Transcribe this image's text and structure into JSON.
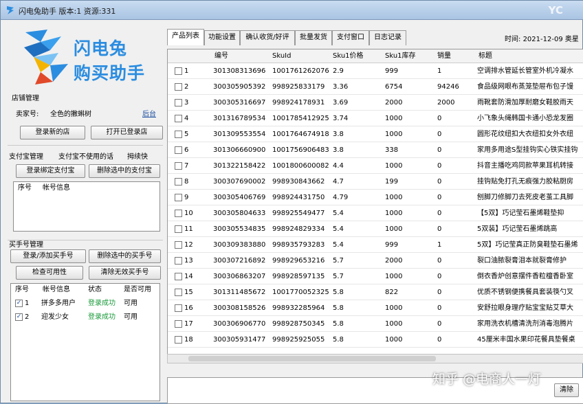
{
  "window": {
    "title": "闪电兔助手  版本:1  资源:331",
    "corner": "YC"
  },
  "logo": {
    "line1": "闪电兔",
    "line2": "购买助手"
  },
  "shop": {
    "section": "店铺管理",
    "seller_label": "卖家号:",
    "seller_value": "全色的撇蝌树",
    "backend_link": "后台",
    "login_new": "登录新的店",
    "open_logged": "打开已登录店"
  },
  "alipay": {
    "section": "支付宝管理",
    "note": "支付宝不使用的话",
    "shortcut": "拇续快",
    "bind_btn": "登录绑定支付宝",
    "delete_btn": "删除选中的支付宝",
    "headers": [
      "序号",
      "帐号信息"
    ]
  },
  "buyer": {
    "section": "买手号管理",
    "login_add": "登录/添加买手号",
    "delete_selected": "删除选中的买手号",
    "check": "检查可用性",
    "clear_invalid": "清除无效买手号",
    "headers": [
      "序号",
      "帐号信息",
      "状态",
      "是否可用"
    ],
    "rows": [
      {
        "index": "1",
        "account": "拼多多用户",
        "status": "登录成功",
        "usable": "可用"
      },
      {
        "index": "2",
        "account": "迎发少女",
        "status": "登录成功",
        "usable": "可用"
      }
    ]
  },
  "tabs": [
    "产品列表",
    "功能设置",
    "确认收货/好评",
    "批量发货",
    "支付窗口",
    "日志记录"
  ],
  "time": {
    "label": "时间:",
    "value": "2021-12-09 奥星"
  },
  "table": {
    "headers": [
      "编号",
      "SkuId",
      "Sku1价格",
      "Sku1库存",
      "销量",
      "标题"
    ],
    "rows": [
      [
        "1",
        "301308313696",
        "1001761262076",
        "2.9",
        "999",
        "1",
        "空调排水管延长管室外机冷凝水"
      ],
      [
        "2",
        "300305905392",
        "998925833179",
        "3.36",
        "6754",
        "94246",
        "食品级网眼布蒸笼垫屉布包子馒"
      ],
      [
        "3",
        "300305316697",
        "998924178931",
        "3.69",
        "2000",
        "2000",
        "雨靴套防滑加厚耐磨女鞋胶雨天"
      ],
      [
        "4",
        "301316789534",
        "1001785412925",
        "3.74",
        "1000",
        "0",
        "小飞象头绳韩国卡通小恐龙发圈"
      ],
      [
        "5",
        "301309553554",
        "1001764674918",
        "3.8",
        "1000",
        "0",
        "圆形花纹纽扣大衣纽扣女外衣纽"
      ],
      [
        "6",
        "301306660900",
        "1001756906483",
        "3.8",
        "338",
        "0",
        "家用多用途S型挂钩实心铁实挂钩"
      ],
      [
        "7",
        "301322158422",
        "1001800600082",
        "4.4",
        "1000",
        "0",
        "抖音主播吃鸡同款苹果耳机转接"
      ],
      [
        "8",
        "300307690002",
        "998930843662",
        "4.7",
        "199",
        "0",
        "挂钩贴免打孔无痕强力胶粘厨房"
      ],
      [
        "9",
        "300305406769",
        "998924431750",
        "4.79",
        "1000",
        "0",
        "刨脚刀修脚刀去死皮老茧工具脚"
      ],
      [
        "10",
        "300305804633",
        "998925549477",
        "5.4",
        "1000",
        "0",
        "【5双】巧记莹石墨烯鞋垫抑"
      ],
      [
        "11",
        "300305534835",
        "998924829334",
        "5.4",
        "1000",
        "0",
        "5双装】巧记莹石墨烯跳高"
      ],
      [
        "12",
        "300309383880",
        "998935793283",
        "5.4",
        "999",
        "1",
        "5双】巧记莹真正防臭鞋垫石墨烯"
      ],
      [
        "13",
        "300307216892",
        "998929653216",
        "5.7",
        "2000",
        "0",
        "裂口油脓裂膏泪本就裂膏修护"
      ],
      [
        "14",
        "300306863207",
        "998928597135",
        "5.7",
        "1000",
        "0",
        "倒衣香炉创意摆件香粒檀香卧室"
      ],
      [
        "15",
        "301311485672",
        "1001770052325",
        "5.8",
        "822",
        "0",
        "优质不锈钢便携餐具套装筷勺叉"
      ],
      [
        "16",
        "300308158526",
        "998932285964",
        "5.8",
        "1000",
        "0",
        "安舒拉眼身理疗贴宝宝贴艾草大"
      ],
      [
        "17",
        "300306906770",
        "998928750345",
        "5.8",
        "1000",
        "0",
        "家用洗衣机槽清洗剂消毒泡腾片"
      ],
      [
        "18",
        "300305931477",
        "998925925055",
        "5.8",
        "1000",
        "0",
        "45厘米丰国水果印花餐具垫餐桌"
      ]
    ]
  },
  "log": {
    "btn": "清除"
  },
  "watermark": "知乎 @电商人一灯",
  "colors": {
    "title_bar": "#b8cfea",
    "logo_blue": "#2b8de0",
    "success": "#1a9a3a"
  }
}
